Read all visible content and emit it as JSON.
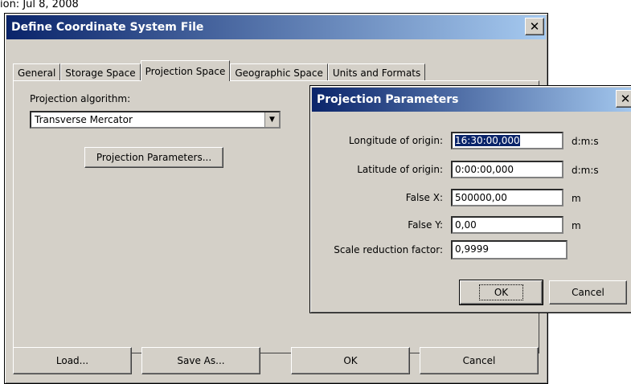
{
  "top_text": "ion: Jul 8, 2008",
  "main": {
    "title": "Define Coordinate System File",
    "tabs": [
      {
        "label": "General"
      },
      {
        "label": "Storage Space"
      },
      {
        "label": "Projection Space"
      },
      {
        "label": "Geographic Space"
      },
      {
        "label": "Units and Formats"
      }
    ],
    "active_tab": "Projection Space",
    "algorithm_label": "Projection algorithm:",
    "algorithm_value": "Transverse Mercator",
    "params_button": "Projection Parameters...",
    "buttons": {
      "load": "Load...",
      "save_as": "Save As...",
      "ok": "OK",
      "cancel": "Cancel"
    }
  },
  "params": {
    "title": "Projection Parameters",
    "fields": [
      {
        "label": "Longitude of origin:",
        "value": "16:30:00,000",
        "unit": "d:m:s"
      },
      {
        "label": "Latitude of origin:",
        "value": "0:00:00,000",
        "unit": "d:m:s"
      },
      {
        "label": "False X:",
        "value": "500000,00",
        "unit": "m"
      },
      {
        "label": "False Y:",
        "value": "0,00",
        "unit": "m"
      },
      {
        "label": "Scale reduction factor:",
        "value": "0,9999",
        "unit": ""
      }
    ],
    "ok": "OK",
    "cancel": "Cancel"
  },
  "icons": {
    "close": "close-icon",
    "dropdown": "chevron-down-icon"
  }
}
